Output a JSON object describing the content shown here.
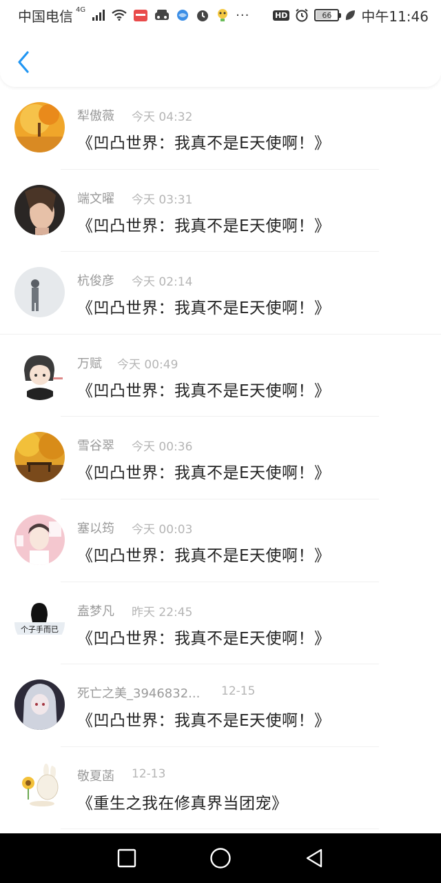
{
  "status_bar": {
    "carrier": "中国电信",
    "network": "4G",
    "hd": "HD",
    "battery": "66",
    "time": "中午11:46"
  },
  "nav": {
    "back_icon": "chevron-left-icon",
    "accent_color": "#2196f3"
  },
  "comments": [
    {
      "name": "犁傲薇",
      "time": "今天 04:32",
      "title": "《凹凸世界：我真不是E天使啊！》",
      "avatar": "autumn-tree-avatar"
    },
    {
      "name": "端文曜",
      "time": "今天 03:31",
      "title": "《凹凸世界：我真不是E天使啊！》",
      "avatar": "girl-portrait-avatar"
    },
    {
      "name": "杭俊彦",
      "time": "今天 02:14",
      "title": "《凹凸世界：我真不是E天使啊！》",
      "avatar": "person-fog-avatar"
    },
    {
      "name": "万赋",
      "time": "今天 00:49",
      "title": "《凹凸世界：我真不是E天使啊！》",
      "avatar": "anime-boy-avatar"
    },
    {
      "name": "雪谷翠",
      "time": "今天 00:36",
      "title": "《凹凸世界：我真不是E天使啊！》",
      "avatar": "bench-autumn-avatar"
    },
    {
      "name": "塞以筠",
      "time": "今天 00:03",
      "title": "《凹凸世界：我真不是E天使啊！》",
      "avatar": "birthday-idol-avatar"
    },
    {
      "name": "盍梦凡",
      "time": "昨天 22:45",
      "title": "《凹凸世界：我真不是E天使啊！》",
      "avatar": "bw-text-avatar",
      "avatar_text": "个子手而已"
    },
    {
      "name": "死亡之美_3946832...",
      "time": "12-15",
      "title": "《凹凸世界：我真不是E天使啊！》",
      "avatar": "anime-silver-hair-avatar"
    },
    {
      "name": "敬夏菡",
      "time": "12-13",
      "title": "《重生之我在修真界当团宠》",
      "avatar": "bunny-sunflower-avatar"
    }
  ],
  "system_nav": {
    "recent": "square-icon",
    "home": "circle-icon",
    "back": "triangle-back-icon"
  }
}
